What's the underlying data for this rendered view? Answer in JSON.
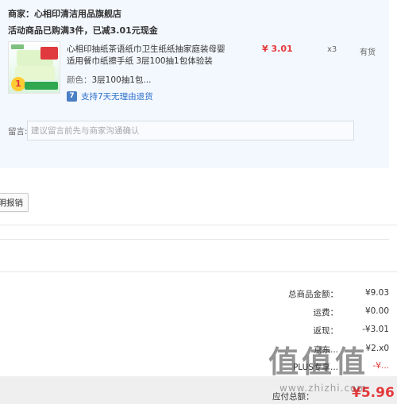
{
  "store": {
    "label": "商家：",
    "name": "心相印清洁用品旗舰店"
  },
  "promo": {
    "text": "活动商品已购满3件，已减3.01元现金"
  },
  "product": {
    "title": "心相印抽纸茶语纸巾卫生纸纸抽家庭装母婴适用餐巾纸擦手纸 3层100抽1包体验装",
    "attr_label": "颜色：",
    "attr_value": "3层100抽1包...",
    "price": "¥ 3.01",
    "qty": "x3",
    "stock": "有货",
    "return_icon": "7",
    "return_text": "支持7天无理由退货"
  },
  "message": {
    "label": "留言:",
    "placeholder": "建议留言前先与商家沟通确认"
  },
  "invoice": {
    "button_label": "明报销"
  },
  "summary": {
    "rows": [
      {
        "label": "总商品金额：",
        "value": "¥9.03"
      },
      {
        "label": "运费：",
        "value": "¥0.00"
      },
      {
        "label": "返现：",
        "value": "-¥3.01"
      },
      {
        "label": "京东...",
        "value": "¥2.x0"
      },
      {
        "label": "PLUS专享...",
        "value": "-¥..."
      }
    ],
    "payable_label": "应付总额：",
    "payable_value": "¥5.96"
  },
  "watermark": {
    "glyphs": "值值值",
    "url": "www.zhizhi.com"
  },
  "colors": {
    "panel_bg": "#f3f8fe",
    "price_red": "#e4393c",
    "link_blue": "#2b6ec9",
    "footer_bg": "#efefef"
  }
}
